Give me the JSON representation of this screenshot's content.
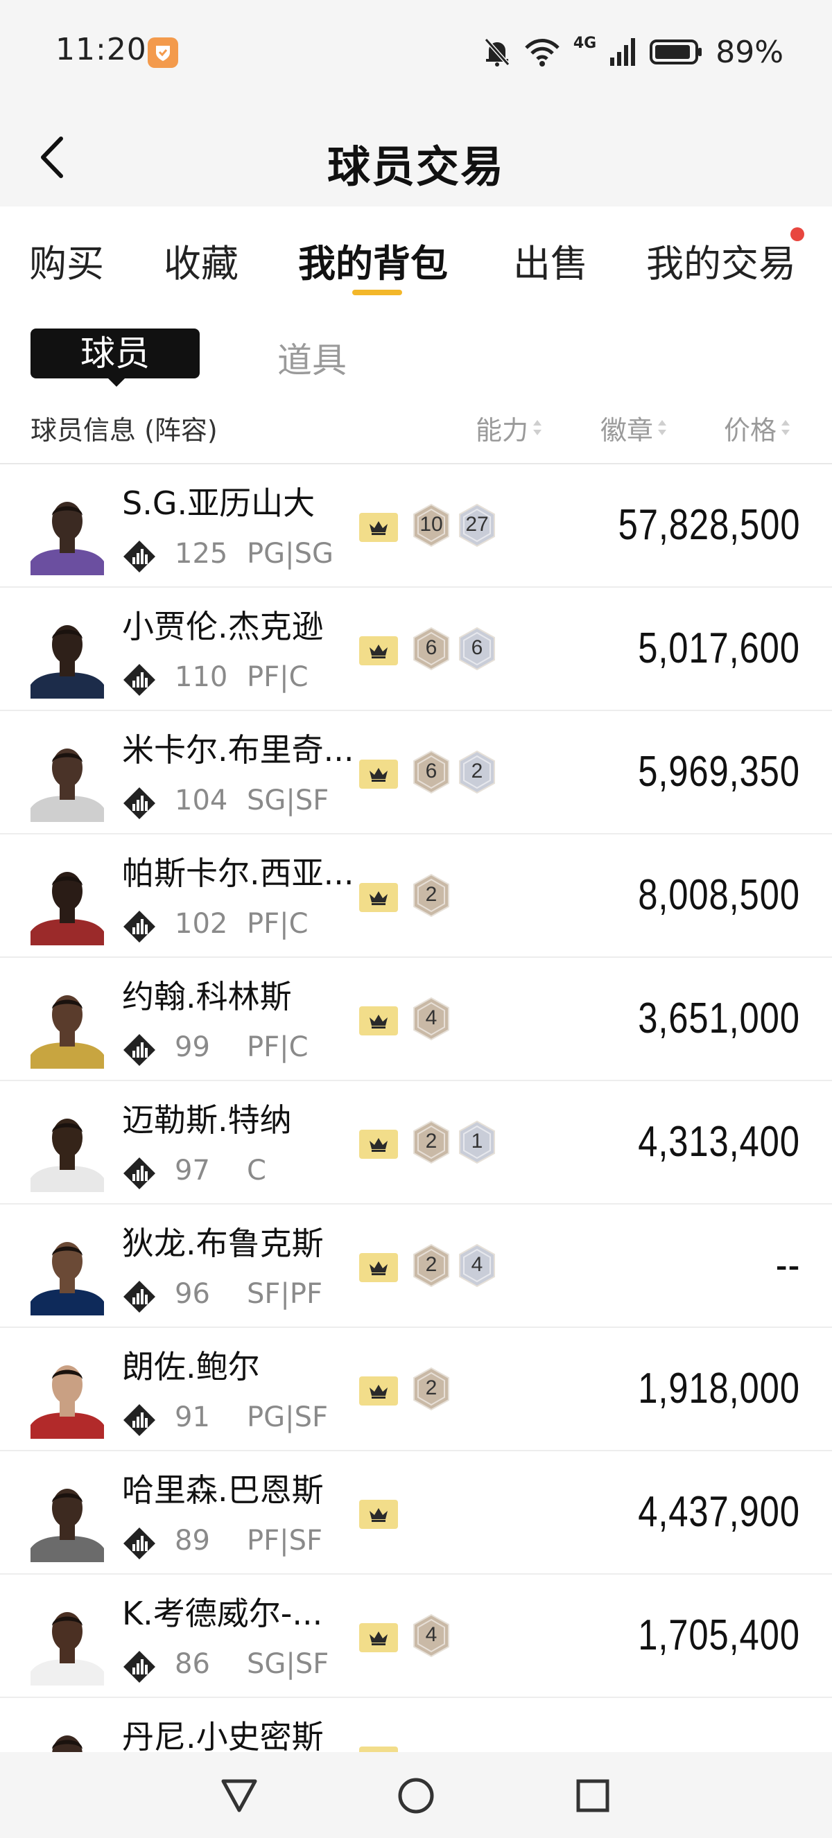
{
  "status_bar": {
    "time": "11:20",
    "network": "4G",
    "battery": "89%"
  },
  "header": {
    "title": "球员交易"
  },
  "tabs": [
    {
      "label": "购买",
      "active": false
    },
    {
      "label": "收藏",
      "active": false
    },
    {
      "label": "我的背包",
      "active": true
    },
    {
      "label": "出售",
      "active": false
    },
    {
      "label": "我的交易",
      "active": false,
      "has_dot": true
    }
  ],
  "sub_tabs": [
    {
      "label": "球员",
      "active": true
    },
    {
      "label": "道具",
      "active": false
    }
  ],
  "columns": {
    "info": "球员信息 (阵容)",
    "ability": "能力",
    "badges": "徽章",
    "price": "价格"
  },
  "players": [
    {
      "name": "S.G.亚历山大",
      "rating": "125",
      "position": "PG|SG",
      "crown": true,
      "badges": [
        "10",
        "27"
      ],
      "price": "57,828,500"
    },
    {
      "name": "小贾伦.杰克逊",
      "rating": "110",
      "position": "PF|C",
      "crown": true,
      "badges": [
        "6",
        "6"
      ],
      "price": "5,017,600"
    },
    {
      "name": "米卡尔.布里奇...",
      "rating": "104",
      "position": "SG|SF",
      "crown": true,
      "badges": [
        "6",
        "2"
      ],
      "price": "5,969,350"
    },
    {
      "name": "帕斯卡尔.西亚...",
      "rating": "102",
      "position": "PF|C",
      "crown": true,
      "badges": [
        "2"
      ],
      "price": "8,008,500"
    },
    {
      "name": "约翰.科林斯",
      "rating": "99",
      "position": "PF|C",
      "crown": true,
      "badges": [
        "4"
      ],
      "price": "3,651,000"
    },
    {
      "name": "迈勒斯.特纳",
      "rating": "97",
      "position": "C",
      "crown": true,
      "badges": [
        "2",
        "1"
      ],
      "price": "4,313,400"
    },
    {
      "name": "狄龙.布鲁克斯",
      "rating": "96",
      "position": "SF|PF",
      "crown": true,
      "badges": [
        "2",
        "4"
      ],
      "price": "--"
    },
    {
      "name": "朗佐.鲍尔",
      "rating": "91",
      "position": "PG|SF",
      "crown": true,
      "badges": [
        "2"
      ],
      "price": "1,918,000"
    },
    {
      "name": "哈里森.巴恩斯",
      "rating": "89",
      "position": "PF|SF",
      "crown": true,
      "badges": [],
      "price": "4,437,900"
    },
    {
      "name": "K.考德威尔-...",
      "rating": "86",
      "position": "SG|SF",
      "crown": true,
      "badges": [
        "4"
      ],
      "price": "1,705,400"
    },
    {
      "name": "丹尼.小史密斯",
      "rating": "",
      "position": "",
      "crown": true,
      "badges": [],
      "price": ""
    }
  ],
  "colors": {
    "accent": "#f3b72a",
    "crown_badge": "#f2dd8a",
    "hex_bronze": "#c9b9a6",
    "hex_silver": "#c9cdd8",
    "notification_dot": "#e8463f"
  }
}
